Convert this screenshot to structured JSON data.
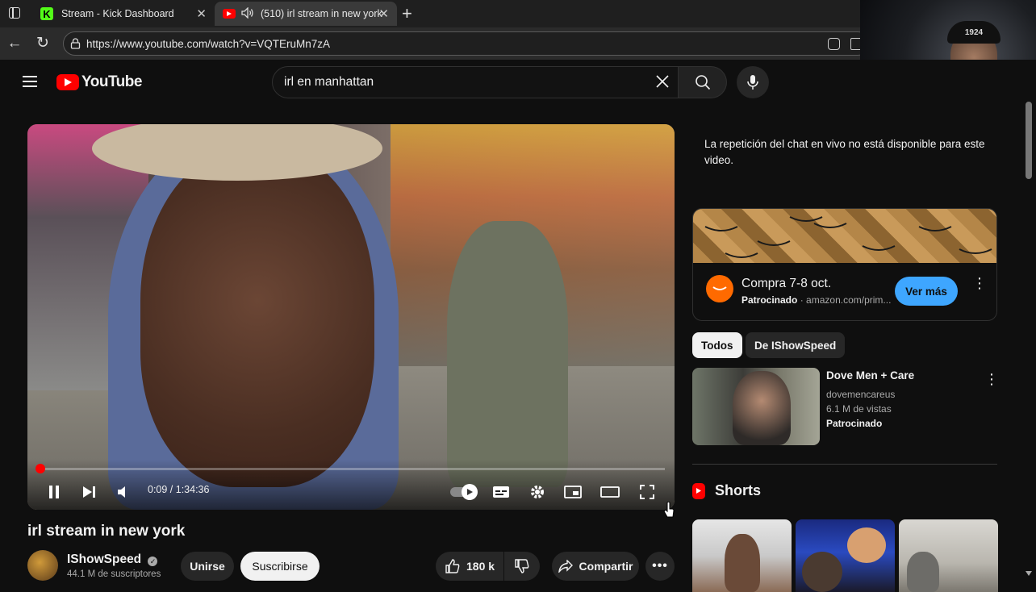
{
  "browser": {
    "tabs": [
      {
        "title": "Stream - Kick Dashboard",
        "favicon": "K"
      },
      {
        "title": "(510) irl stream in new york"
      }
    ],
    "url": "https://www.youtube.com/watch?v=VQTEruMn7zA"
  },
  "youtube": {
    "logo_text": "YouTube",
    "search_query": "irl en manhattan"
  },
  "player": {
    "time": "0:09 / 1:34:36",
    "progress_fraction": 0.0016
  },
  "video": {
    "title": "irl stream in new york",
    "channel": "IShowSpeed",
    "subscribers": "44.1 M de suscriptores",
    "join_label": "Unirse",
    "subscribe_label": "Suscribirse",
    "likes": "180 k",
    "share_label": "Compartir"
  },
  "sidebar": {
    "chat_message": "La repetición del chat en vivo no está disponible para este video.",
    "ad": {
      "title": "Compra 7-8 oct.",
      "sponsored": "Patrocinado",
      "domain": "amazon.com/prim...",
      "cta": "Ver más"
    },
    "chips": [
      "Todos",
      "De IShowSpeed"
    ],
    "recommendation": {
      "title": "Dove Men + Care",
      "channel": "dovemencareus",
      "views": "6.1 M de vistas",
      "sponsored": "Patrocinado"
    },
    "shorts_label": "Shorts"
  },
  "webcam_cap_text": "1924",
  "colors": {
    "youtube_red": "#ff0000",
    "kick_green": "#53fc18",
    "cta_blue": "#3ea6ff",
    "amazon_orange": "#ff6a00"
  }
}
